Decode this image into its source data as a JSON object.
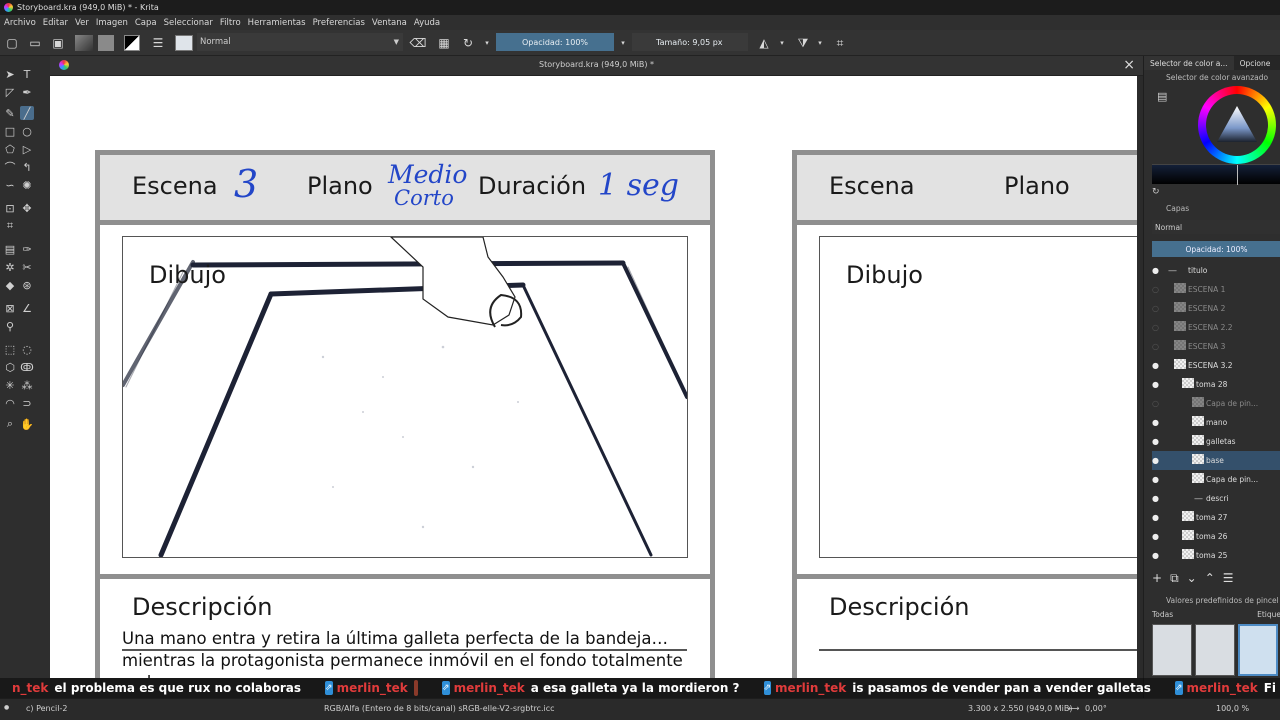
{
  "window": {
    "title": "Storyboard.kra (949,0 MiB) * - Krita"
  },
  "menu": [
    "Archivo",
    "Editar",
    "Ver",
    "Imagen",
    "Capa",
    "Seleccionar",
    "Filtro",
    "Herramientas",
    "Preferencias",
    "Ventana",
    "Ayuda"
  ],
  "toolbar": {
    "blend_mode": "Normal",
    "opacity": "Opacidad: 100%",
    "size": "Tamaño: 9,05 px"
  },
  "document": {
    "tab_title": "Storyboard.kra (949,0 MiB) *"
  },
  "storyboard": {
    "panel1": {
      "scene_label": "Escena",
      "scene_value": "3",
      "shot_label": "Plano",
      "shot_value_line1": "Medio",
      "shot_value_line2": "Corto",
      "duration_label": "Duración",
      "duration_value": "1 seg",
      "drawing_label": "Dibujo",
      "description_label": "Descripción",
      "description_line1": "Una mano entra y retira la última galleta perfecta de la bandeja…",
      "description_line2": "mientras la protagonista permanece inmóvil en el fondo totalmente",
      "description_line3": "sola"
    },
    "panel2": {
      "scene_label": "Escena",
      "shot_label": "Plano",
      "drawing_label": "Dibujo",
      "description_label": "Descripción"
    }
  },
  "dock": {
    "tabs": [
      "Selector de color a...",
      "Opcione"
    ],
    "color_selector_title": "Selector de color avanzado",
    "layers_title": "Capas",
    "layers_blend": "Normal",
    "layers_opacity": "Opacidad:  100%",
    "layers": [
      {
        "name": "titulo",
        "visible": true,
        "dim": false
      },
      {
        "name": "ESCENA 1",
        "visible": false,
        "dim": true
      },
      {
        "name": "ESCENA 2",
        "visible": false,
        "dim": true
      },
      {
        "name": "ESCENA 2.2",
        "visible": false,
        "dim": true
      },
      {
        "name": "ESCENA 3",
        "visible": false,
        "dim": true
      },
      {
        "name": "ESCENA 3.2",
        "visible": true,
        "dim": false
      },
      {
        "name": "toma 28",
        "visible": true,
        "dim": false
      },
      {
        "name": "Capa de pin...",
        "visible": false,
        "dim": true
      },
      {
        "name": "mano",
        "visible": true,
        "dim": false
      },
      {
        "name": "galletas",
        "visible": true,
        "dim": false
      },
      {
        "name": "base",
        "visible": true,
        "dim": false,
        "selected": true
      },
      {
        "name": "Capa de pin...",
        "visible": true,
        "dim": false
      },
      {
        "name": "descri",
        "visible": true,
        "dim": false
      },
      {
        "name": "toma 27",
        "visible": true,
        "dim": false
      },
      {
        "name": "toma 26",
        "visible": true,
        "dim": false
      },
      {
        "name": "toma 25",
        "visible": true,
        "dim": false
      }
    ],
    "brush_presets_title": "Valores predefinidos de pincel",
    "brush_filter": "Todas",
    "brush_tag": "Etique"
  },
  "chat": {
    "messages": [
      {
        "user": "n_tek",
        "text": "el problema es que rux no colaboras"
      },
      {
        "user": "merlin_tek",
        "text": ""
      },
      {
        "user": "merlin_tek",
        "text": "a esa galleta ya la mordieron ?"
      },
      {
        "user": "merlin_tek",
        "text": "is pasamos de vender pan a vender galletas"
      },
      {
        "user": "merlin_tek",
        "text": ""
      }
    ],
    "trailing": "Fi"
  },
  "status": {
    "brush": "c) Pencil-2",
    "color_space": "RGB/Alfa (Entero de 8 bits/canal)  sRGB-elle-V2-srgbtrc.icc",
    "dimensions": "3.300 x 2.550 (949,0 MiB)",
    "rotation": "0,00°",
    "zoom": "100,0 %"
  }
}
